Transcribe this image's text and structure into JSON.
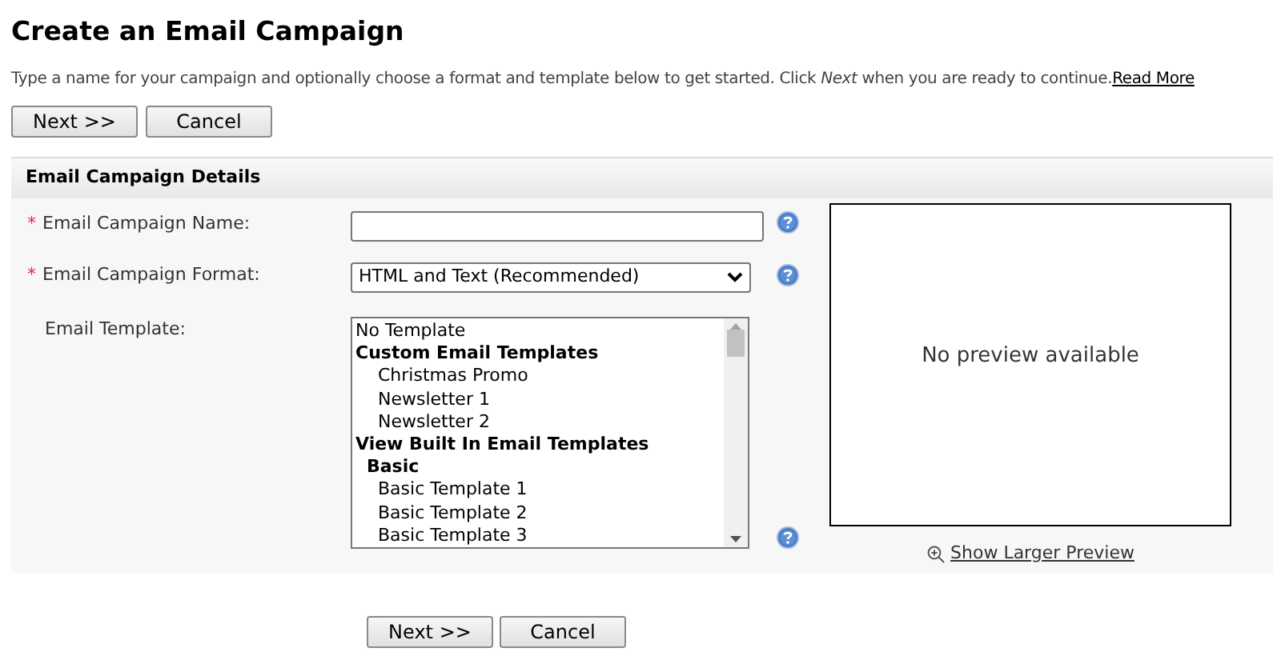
{
  "title": "Create an Email Campaign",
  "intro": "Type a name for your campaign and optionally choose a format and template below to get started. Click *Next* when you are ready to continue.",
  "read_more": "Read More",
  "top_buttons": [
    "Next >>",
    "Cancel"
  ],
  "section_title": "Email Campaign Details",
  "fields": [
    {
      "kind": "text",
      "label": "Email Campaign Name:",
      "required_mark": "*"
    },
    {
      "kind": "select",
      "label": "Email Campaign Format:",
      "required_mark": "*",
      "value": "HTML and Text (Recommended)"
    },
    {
      "kind": "list",
      "label": "Email Template:",
      "options": [
        {
          "kind": "option",
          "label": "No Template"
        },
        {
          "kind": "group",
          "label": "Custom Email Templates",
          "children": [
            {
              "kind": "option",
              "label": "Christmas Promo"
            },
            {
              "kind": "option",
              "label": "Newsletter 1"
            },
            {
              "kind": "option",
              "label": "Newsletter 2"
            }
          ]
        },
        {
          "kind": "group",
          "label": "View Built In Email Templates",
          "children": [
            {
              "kind": "group",
              "label": "Basic",
              "children": [
                {
                  "kind": "option",
                  "label": "Basic Template 1"
                },
                {
                  "kind": "option",
                  "label": "Basic Template 2"
                },
                {
                  "kind": "option",
                  "label": "Basic Template 3"
                }
              ]
            }
          ]
        }
      ]
    }
  ],
  "preview": {
    "text": "No preview available",
    "link": "Show Larger Preview"
  },
  "bottom_buttons": [
    "Next >>",
    "Cancel"
  ]
}
